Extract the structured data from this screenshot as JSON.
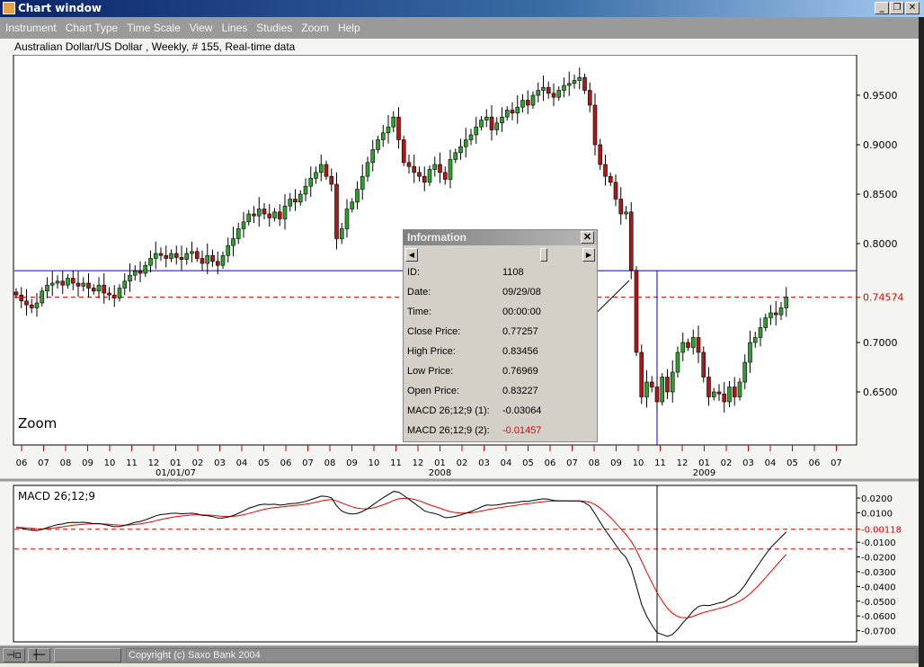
{
  "window": {
    "title": "Chart window",
    "minimize": "_",
    "restore": "❐",
    "close": "✕"
  },
  "menu": [
    "Instrument",
    "Chart Type",
    "Time Scale",
    "View",
    "Lines",
    "Studies",
    "Zoom",
    "Help"
  ],
  "chart_header": "Australian Dollar/US Dollar , Weekly, # 155, Real-time data",
  "zoom_label": "Zoom",
  "colors": {
    "up": "#2fa02f",
    "down": "#b01818",
    "price_line": "#0000cc",
    "dashed": "#dd0000"
  },
  "chart_data": {
    "type": "candlestick",
    "title": "Australian Dollar/US Dollar , Weekly",
    "ylim": [
      0.6,
      0.985
    ],
    "yticks": [
      "0.9500",
      "0.9000",
      "0.8500",
      "0.8000",
      "0.7000",
      "0.6500"
    ],
    "ytick_values": [
      0.95,
      0.9,
      0.85,
      0.8,
      0.7,
      0.65
    ],
    "current_price_label": "0.74574",
    "current_price": 0.74574,
    "cursor_price": 0.77257,
    "month_labels": [
      "06",
      "07",
      "08",
      "09",
      "10",
      "11",
      "12",
      "01",
      "02",
      "03",
      "04",
      "05",
      "06",
      "07",
      "08",
      "09",
      "10",
      "11",
      "12",
      "01",
      "02",
      "03",
      "04",
      "05",
      "06",
      "07",
      "08",
      "09",
      "10",
      "11",
      "12",
      "01",
      "02",
      "03",
      "04",
      "05",
      "06",
      "07"
    ],
    "year_labels": [
      {
        "label": "01/01/07",
        "month_index": 7
      },
      {
        "label": "2008",
        "month_index": 19
      },
      {
        "label": "2009",
        "month_index": 31
      }
    ],
    "cursor_index": 124,
    "closes": [
      0.748,
      0.742,
      0.738,
      0.735,
      0.74,
      0.752,
      0.758,
      0.76,
      0.762,
      0.758,
      0.765,
      0.76,
      0.757,
      0.76,
      0.755,
      0.752,
      0.758,
      0.75,
      0.748,
      0.745,
      0.755,
      0.762,
      0.768,
      0.772,
      0.77,
      0.778,
      0.785,
      0.79,
      0.788,
      0.785,
      0.79,
      0.786,
      0.784,
      0.79,
      0.792,
      0.785,
      0.78,
      0.788,
      0.782,
      0.778,
      0.788,
      0.798,
      0.805,
      0.815,
      0.822,
      0.83,
      0.828,
      0.835,
      0.83,
      0.826,
      0.832,
      0.825,
      0.838,
      0.845,
      0.842,
      0.85,
      0.858,
      0.866,
      0.872,
      0.88,
      0.868,
      0.86,
      0.805,
      0.815,
      0.835,
      0.842,
      0.855,
      0.868,
      0.882,
      0.895,
      0.905,
      0.912,
      0.918,
      0.928,
      0.905,
      0.882,
      0.878,
      0.872,
      0.868,
      0.862,
      0.875,
      0.88,
      0.872,
      0.865,
      0.885,
      0.892,
      0.898,
      0.905,
      0.91,
      0.918,
      0.925,
      0.928,
      0.915,
      0.922,
      0.928,
      0.935,
      0.932,
      0.938,
      0.945,
      0.94,
      0.95,
      0.955,
      0.958,
      0.952,
      0.948,
      0.955,
      0.96,
      0.962,
      0.965,
      0.968,
      0.955,
      0.94,
      0.9,
      0.88,
      0.868,
      0.862,
      0.845,
      0.83,
      0.832,
      0.773,
      0.69,
      0.645,
      0.66,
      0.655,
      0.64,
      0.665,
      0.65,
      0.67,
      0.69,
      0.7,
      0.695,
      0.705,
      0.69,
      0.665,
      0.645,
      0.65,
      0.648,
      0.64,
      0.655,
      0.645,
      0.66,
      0.68,
      0.7,
      0.705,
      0.715,
      0.725,
      0.73,
      0.728,
      0.735,
      0.746
    ],
    "macd": {
      "label": "MACD 26;12;9",
      "fast": 12,
      "slow": 26,
      "signal": 9,
      "yticks": [
        "0.0200",
        "0.0100",
        "-0.00118",
        "-0.0100",
        "-0.0200",
        "-0.0300",
        "-0.0400",
        "-0.0500",
        "-0.0600",
        "-0.0700"
      ],
      "ytick_values": [
        0.02,
        0.01,
        -0.00118,
        -0.01,
        -0.02,
        -0.03,
        -0.04,
        -0.05,
        -0.06,
        -0.07
      ],
      "ylim": [
        -0.075,
        0.029
      ],
      "hline_1": -0.00118,
      "hline_2": -0.01457
    }
  },
  "info": {
    "title": "Information",
    "rows": [
      {
        "k": "ID:",
        "v": "1108"
      },
      {
        "k": "Date:",
        "v": "09/29/08"
      },
      {
        "k": "Time:",
        "v": "00:00:00"
      },
      {
        "k": "Close Price:",
        "v": "0.77257"
      },
      {
        "k": "High Price:",
        "v": "0.83456"
      },
      {
        "k": "Low Price:",
        "v": "0.76969"
      },
      {
        "k": "Open Price:",
        "v": "0.83227"
      },
      {
        "k": "MACD 26;12;9 (1):",
        "v": "-0.03064"
      },
      {
        "k": "MACD 26;12;9 (2):",
        "v": "-0.01457"
      }
    ]
  },
  "status": {
    "copyright": "Copyright (c) Saxo Bank 2004"
  }
}
